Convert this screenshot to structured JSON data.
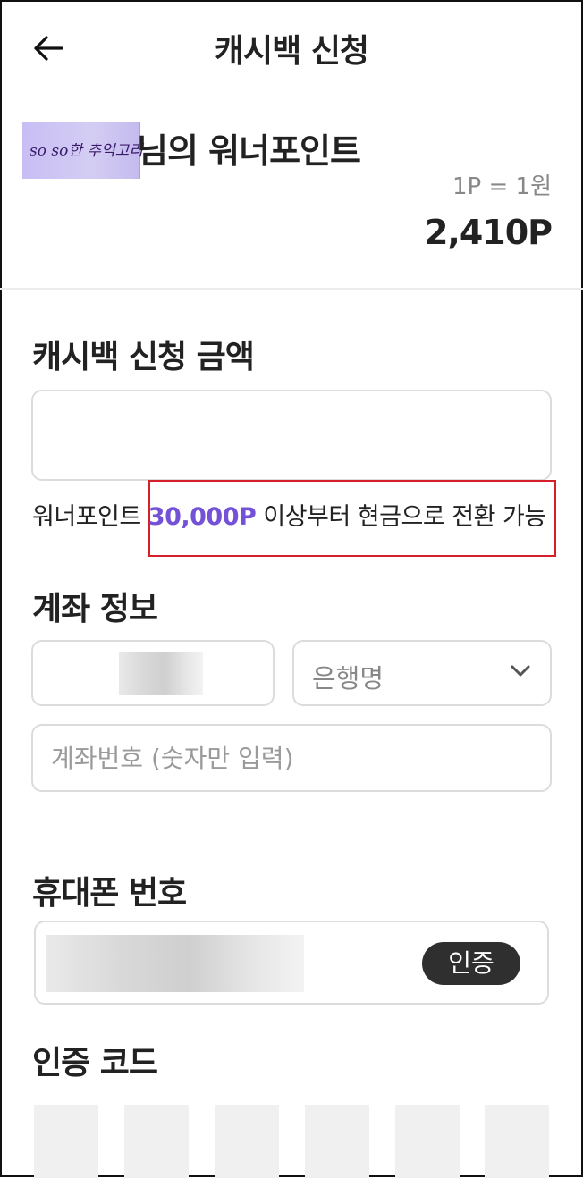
{
  "header": {
    "title": "캐시백 신청",
    "back_icon": "arrow-left-icon"
  },
  "points": {
    "user_badge_text": "so so한 추억고리",
    "title": "님의 워너포인트",
    "rate": "1P = 1원",
    "balance": "2,410P"
  },
  "cashback": {
    "section_title": "캐시백 신청 금액",
    "amount_value": "",
    "notice_prefix": "워너포인트 ",
    "notice_highlight": "30,000P",
    "notice_suffix": " 이상부터 현금으로 전환 가능"
  },
  "account": {
    "section_title": "계좌 정보",
    "bank_placeholder": "은행명",
    "number_placeholder": "계좌번호 (숫자만 입력)"
  },
  "phone": {
    "section_title": "휴대폰 번호",
    "verify_label": "인증"
  },
  "code": {
    "section_title": "인증 코드",
    "digits": 6
  },
  "colors": {
    "accent": "#7452d8",
    "highlight_box": "#d4202a",
    "button_dark": "#2f2f2f"
  }
}
